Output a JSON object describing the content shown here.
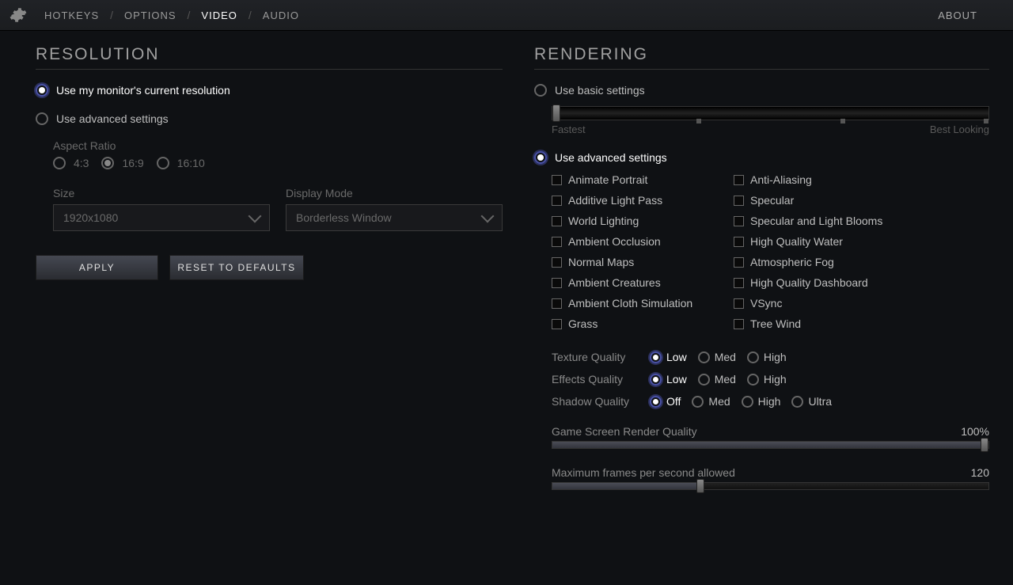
{
  "nav": {
    "hotkeys": "HOTKEYS",
    "options": "OPTIONS",
    "video": "VIDEO",
    "audio": "AUDIO",
    "about": "ABOUT"
  },
  "resolution": {
    "title": "RESOLUTION",
    "use_monitor": "Use my monitor's current resolution",
    "use_advanced": "Use advanced settings",
    "aspect_label": "Aspect Ratio",
    "aspects": {
      "a43": "4:3",
      "a169": "16:9",
      "a1610": "16:10"
    },
    "size_label": "Size",
    "size_value": "1920x1080",
    "mode_label": "Display Mode",
    "mode_value": "Borderless Window",
    "apply": "APPLY",
    "reset": "RESET TO DEFAULTS"
  },
  "rendering": {
    "title": "RENDERING",
    "use_basic": "Use basic settings",
    "slider_fastest": "Fastest",
    "slider_best": "Best Looking",
    "use_advanced": "Use advanced settings",
    "checks_left": [
      "Animate Portrait",
      "Additive Light Pass",
      "World Lighting",
      "Ambient Occlusion",
      "Normal Maps",
      "Ambient Creatures",
      "Ambient Cloth Simulation",
      "Grass"
    ],
    "checks_right": [
      "Anti-Aliasing",
      "Specular",
      "Specular and Light Blooms",
      "High Quality Water",
      "Atmospheric Fog",
      "High Quality Dashboard",
      "VSync",
      "Tree Wind"
    ],
    "texture_label": "Texture Quality",
    "effects_label": "Effects Quality",
    "shadow_label": "Shadow Quality",
    "opts": {
      "low": "Low",
      "med": "Med",
      "high": "High",
      "off": "Off",
      "ultra": "Ultra"
    },
    "render_quality_label": "Game Screen Render Quality",
    "render_quality_value": "100%",
    "fps_label": "Maximum frames per second allowed",
    "fps_value": "120"
  }
}
